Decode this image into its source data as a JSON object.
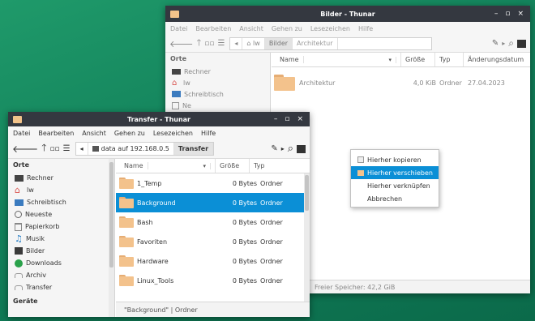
{
  "back_window": {
    "title": "Bilder - Thunar",
    "controls": {
      "minimize": "–",
      "maximize": "▫",
      "close": "×"
    },
    "menu": [
      "Datei",
      "Bearbeiten",
      "Ansicht",
      "Gehen zu",
      "Lesezeichen",
      "Hilfe"
    ],
    "path": [
      "Bilder",
      "Architektur"
    ],
    "sidebar_heading": "Orte",
    "sidebar_items": [
      {
        "label": "Rechner",
        "icon": "computer-icon"
      },
      {
        "label": "lw",
        "icon": "home-icon"
      },
      {
        "label": "Schreibtisch",
        "icon": "desktop-icon"
      },
      {
        "label": "Ne",
        "icon": "trash-icon"
      }
    ],
    "columns": {
      "name": "Name",
      "size": "Größe",
      "type": "Typ",
      "date": "Änderungsdatum"
    },
    "rows": [
      {
        "name": "Architektur",
        "size": "4,0 KiB",
        "type": "Ordner",
        "date": "27.04.2023"
      }
    ],
    "status": "Freier Speicher: 42,2 GiB"
  },
  "front_window": {
    "title": "Transfer - Thunar",
    "controls": {
      "minimize": "–",
      "maximize": "▫",
      "close": "×"
    },
    "menu": [
      "Datei",
      "Bearbeiten",
      "Ansicht",
      "Gehen zu",
      "Lesezeichen",
      "Hilfe"
    ],
    "path": [
      "data auf 192.168.0.5",
      "Transfer"
    ],
    "sidebar_heading": "Orte",
    "sidebar_items": [
      {
        "label": "Rechner",
        "icon": "computer-icon"
      },
      {
        "label": "lw",
        "icon": "home-icon"
      },
      {
        "label": "Schreibtisch",
        "icon": "desktop-icon"
      },
      {
        "label": "Neueste",
        "icon": "recent-icon"
      },
      {
        "label": "Papierkorb",
        "icon": "trash-icon"
      },
      {
        "label": "Musik",
        "icon": "music-icon"
      },
      {
        "label": "Bilder",
        "icon": "pictures-icon"
      },
      {
        "label": "Downloads",
        "icon": "downloads-icon"
      },
      {
        "label": "Archiv",
        "icon": "archive-icon"
      },
      {
        "label": "Transfer",
        "icon": "transfer-icon"
      }
    ],
    "sidebar_heading2": "Geräte",
    "columns": {
      "name": "Name",
      "size": "Größe",
      "type": "Typ"
    },
    "rows": [
      {
        "name": "1_Temp",
        "size": "0 Bytes",
        "type": "Ordner"
      },
      {
        "name": "Background",
        "size": "0 Bytes",
        "type": "Ordner"
      },
      {
        "name": "Bash",
        "size": "0 Bytes",
        "type": "Ordner"
      },
      {
        "name": "Favoriten",
        "size": "0 Bytes",
        "type": "Ordner"
      },
      {
        "name": "Hardware",
        "size": "0 Bytes",
        "type": "Ordner"
      },
      {
        "name": "Linux_Tools",
        "size": "0 Bytes",
        "type": "Ordner"
      }
    ],
    "selected_row": "Background",
    "status": "\"Background\"  |  Ordner"
  },
  "context_menu": {
    "items": [
      "Hierher kopieren",
      "Hierher verschieben",
      "Hierher verknüpfen",
      "Abbrechen"
    ],
    "highlighted": "Hierher verschieben"
  },
  "colors": {
    "titlebar": "#343840",
    "selection": "#0b8fd6",
    "folder": "#f3c28c",
    "desktop": "#12805a"
  }
}
